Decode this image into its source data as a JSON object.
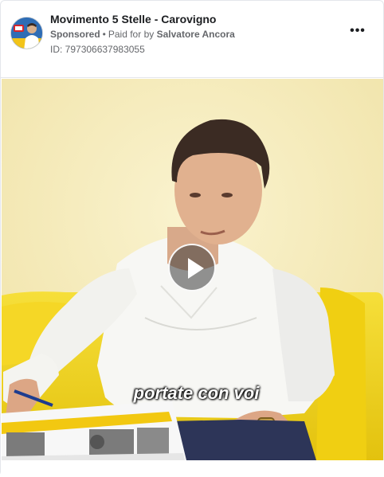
{
  "ad": {
    "page_name": "Movimento 5 Stelle - Carovigno",
    "sponsored_label": "Sponsored",
    "separator": "•",
    "paid_for_label": "Paid for by",
    "payer_name": "Salvatore Ancora",
    "ad_id": "ID: 797306637983055",
    "more_label": "•••"
  },
  "video": {
    "subtitle": "portate con voi"
  },
  "icons": {
    "more": "more-options-icon",
    "play": "play-icon",
    "avatar": "page-avatar"
  },
  "colors": {
    "page_name": "#1c1e21",
    "secondary_text": "#65676b",
    "border": "#e4e6eb",
    "wall": "#f3e9b8",
    "sofa": "#f2d21a"
  }
}
